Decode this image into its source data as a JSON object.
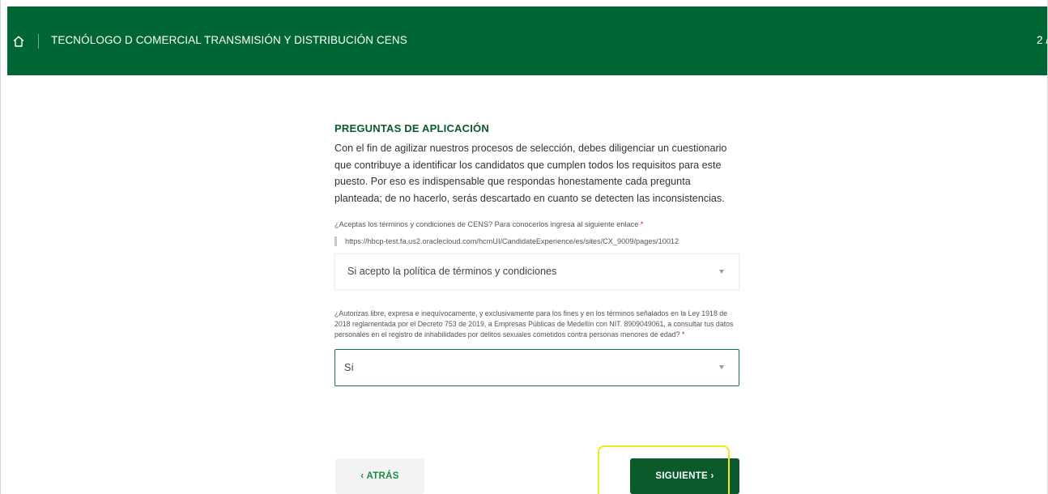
{
  "header": {
    "home_icon": "home-icon",
    "title": "TECNÓLOGO D COMERCIAL TRANSMISIÓN Y DISTRIBUCIÓN CENS",
    "step": "2 /"
  },
  "section": {
    "title": "PREGUNTAS DE APLICACIÓN",
    "intro": "Con el fin de agilizar nuestros procesos de selección, debes diligenciar un cuestionario que contribuye a identificar los candidatos que cumplen todos los requisitos para este puesto. Por eso es indispensable que respondas honestamente cada pregunta planteada; de no hacerlo, serás descartado en cuanto se detecten las inconsistencias."
  },
  "questions": [
    {
      "label": "¿Aceptas los términos y condiciones de CENS? Para conocerlos ingresa al siguiente enlace",
      "required_mark": "*",
      "link": "https://hbcp-test.fa.us2.oraclecloud.com/hcmUI/CandidateExperience/es/sites/CX_9009/pages/10012",
      "selected": "Si acepto la política de términos y condiciones"
    },
    {
      "label": "¿Autorizas libre, expresa e inequívocamente, y exclusivamente para los fines y en los términos señalados en la Ley 1918 de 2018 reglamentada por el Decreto 753 de 2019, a Empresas Públicas de Medellín con NIT. 8909049061, a consultar tus datos personales en el registro de inhabilidades por delitos sexuales cometidos contra personas menores de edad?",
      "required_mark": "*",
      "selected": "Sí"
    }
  ],
  "buttons": {
    "back": "‹ ATRÁS",
    "next": "SIGUIENTE ›"
  },
  "colors": {
    "brand_green": "#006633",
    "button_green": "#0b5a2c",
    "link_green": "#1d8a46",
    "highlight": "#f4e61a"
  }
}
